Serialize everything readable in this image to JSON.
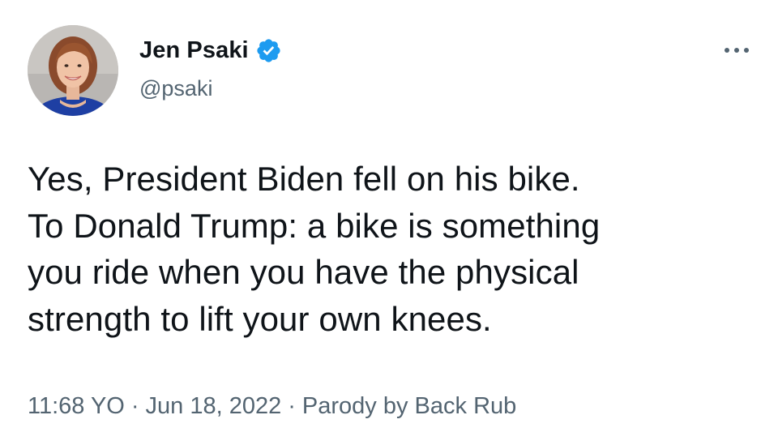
{
  "author": {
    "display_name": "Jen Psaki",
    "handle": "@psaki",
    "verified_icon": "verified-badge-icon",
    "avatar_icon": "profile-photo"
  },
  "menu": {
    "icon": "more-options-icon"
  },
  "tweet": {
    "lines": [
      "Yes, President Biden fell on his bike.",
      "To Donald Trump: a bike is something",
      "you ride when you have the physical",
      "strength to lift your own knees."
    ]
  },
  "meta": {
    "time": "11:68 YO",
    "separator": "·",
    "date": "Jun 18, 2022",
    "source": "Parody by Back Rub"
  },
  "colors": {
    "text": "#0f1419",
    "secondary": "#536471",
    "verified": "#1d9bf0"
  }
}
